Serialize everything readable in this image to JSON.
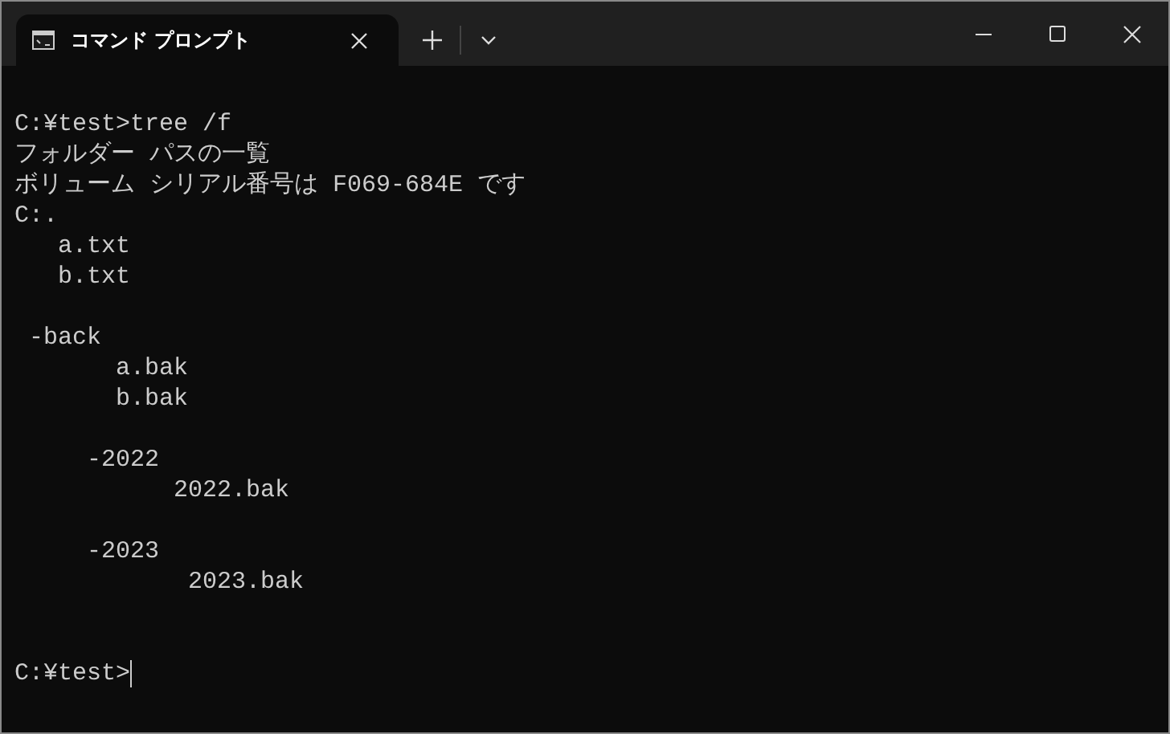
{
  "tab": {
    "title": "コマンド プロンプト",
    "selected": true
  },
  "terminal": {
    "lines": [
      {
        "kind": "blank"
      },
      {
        "kind": "output",
        "text": "C:¥test>tree /f"
      },
      {
        "kind": "output",
        "text": "フォルダー パスの一覧"
      },
      {
        "kind": "output",
        "text": "ボリューム シリアル番号は F069-684E です"
      },
      {
        "kind": "output",
        "text": "C:."
      },
      {
        "kind": "output",
        "text": "   a.txt"
      },
      {
        "kind": "output",
        "text": "   b.txt"
      },
      {
        "kind": "blank"
      },
      {
        "kind": "output",
        "text": " -back"
      },
      {
        "kind": "output",
        "text": "       a.bak"
      },
      {
        "kind": "output",
        "text": "       b.bak"
      },
      {
        "kind": "blank"
      },
      {
        "kind": "output",
        "text": "     -2022"
      },
      {
        "kind": "output",
        "text": "           2022.bak"
      },
      {
        "kind": "blank"
      },
      {
        "kind": "output",
        "text": "     -2023"
      },
      {
        "kind": "output",
        "text": "            2023.bak"
      },
      {
        "kind": "blank"
      },
      {
        "kind": "blank"
      },
      {
        "kind": "prompt",
        "text": "C:¥test>"
      }
    ]
  }
}
